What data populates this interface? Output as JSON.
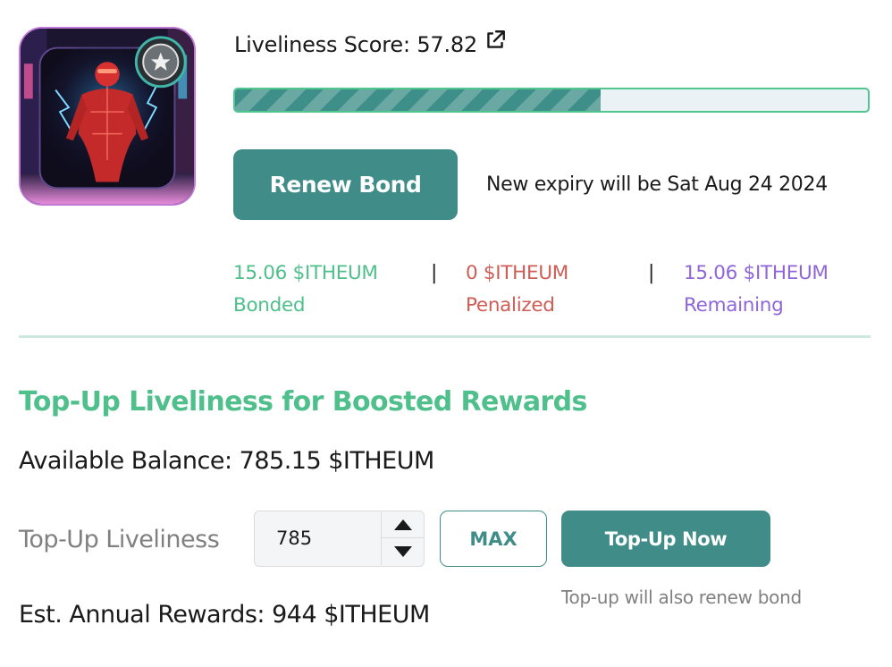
{
  "nft": {
    "image_alt": "Glowing red robotic humanoid figure in neon city street",
    "badge_icon": "rank-badge-icon"
  },
  "liveliness": {
    "label": "Liveliness Score:",
    "score": "57.82",
    "score_value": 57.82,
    "external_link_icon": "external-link-icon"
  },
  "renew": {
    "button_label": "Renew Bond",
    "expiry_text": "New expiry will be Sat Aug 24 2024"
  },
  "stats": {
    "bonded_amount": "15.06 $ITHEUM",
    "bonded_label": "Bonded",
    "penalized_amount": "0 $ITHEUM",
    "penalized_label": "Penalized",
    "remaining_amount": "15.06 $ITHEUM",
    "remaining_label": "Remaining",
    "separator": "|"
  },
  "topup": {
    "section_title": "Top-Up Liveliness for Boosted Rewards",
    "available_balance": "Available Balance: 785.15 $ITHEUM",
    "field_label": "Top-Up Liveliness",
    "field_value": "785",
    "max_label": "MAX",
    "submit_label": "Top-Up Now",
    "note": "Top-up will also renew bond",
    "est_rewards": "Est. Annual Rewards: 944 $ITHEUM"
  },
  "colors": {
    "brand_teal": "#3f8c89",
    "green": "#4fbf8c",
    "red": "#cf5c55",
    "purple": "#8f66d9"
  }
}
